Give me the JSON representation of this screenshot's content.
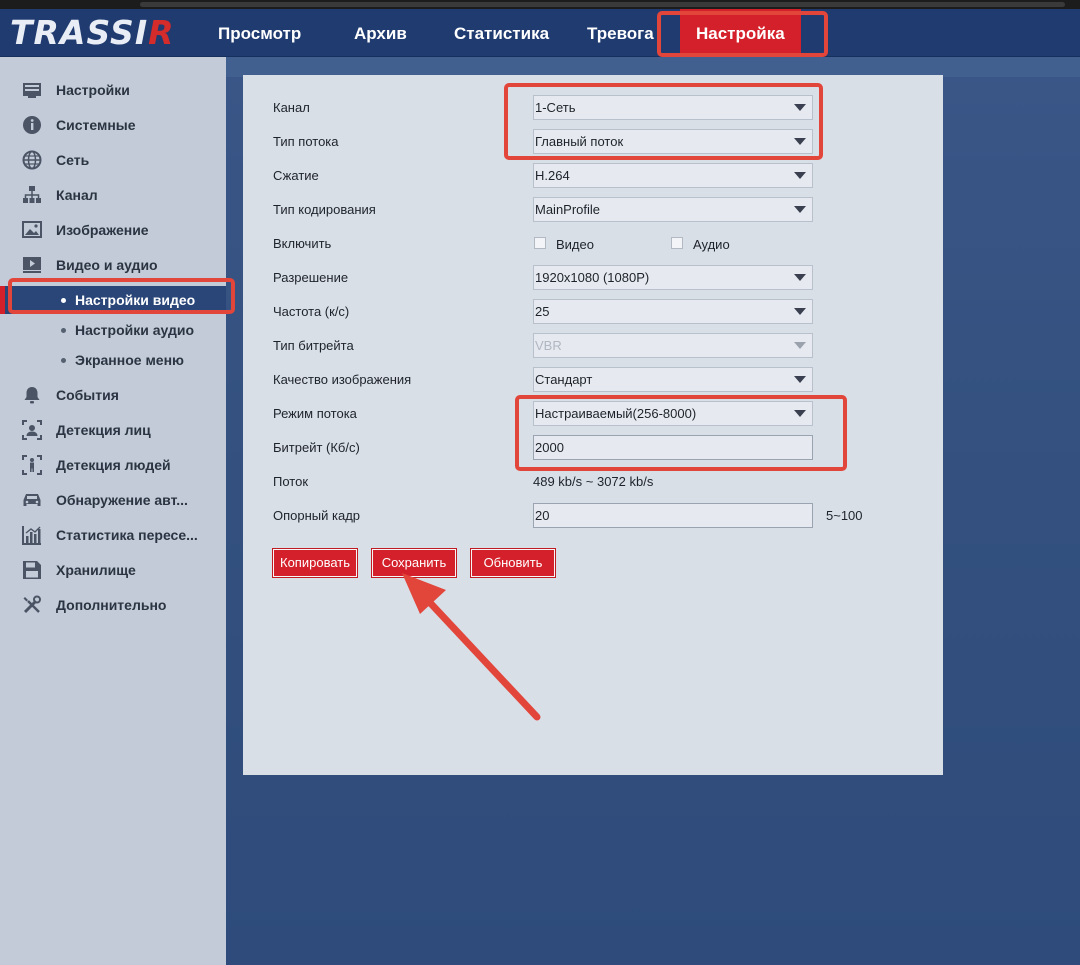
{
  "header": {
    "logo_main": "TRASSI",
    "logo_r": "R",
    "nav": [
      {
        "label": "Просмотр"
      },
      {
        "label": "Архив"
      },
      {
        "label": "Статистика"
      },
      {
        "label": "Тревога"
      },
      {
        "label": "Настройка",
        "active": true
      }
    ]
  },
  "sidebar": {
    "items": [
      {
        "label": "Настройки",
        "icon": "settings-icon"
      },
      {
        "label": "Системные",
        "icon": "info-icon"
      },
      {
        "label": "Сеть",
        "icon": "globe-icon"
      },
      {
        "label": "Канал",
        "icon": "channel-tree-icon"
      },
      {
        "label": "Изображение",
        "icon": "image-icon"
      },
      {
        "label": "Видео и аудио",
        "icon": "video-icon"
      }
    ],
    "subitems": [
      {
        "label": "Настройки видео",
        "active": true
      },
      {
        "label": "Настройки аудио"
      },
      {
        "label": "Экранное меню"
      }
    ],
    "items2": [
      {
        "label": "События",
        "icon": "bell-icon"
      },
      {
        "label": "Детекция лиц",
        "icon": "face-detect-icon"
      },
      {
        "label": "Детекция людей",
        "icon": "person-detect-icon"
      },
      {
        "label": "Обнаружение авт...",
        "icon": "car-icon"
      },
      {
        "label": "Статистика пересе...",
        "icon": "stats-icon"
      },
      {
        "label": "Хранилище",
        "icon": "floppy-icon"
      },
      {
        "label": "Дополнительно",
        "icon": "tools-icon"
      }
    ]
  },
  "form": {
    "channel": {
      "label": "Канал",
      "value": "1-Сеть"
    },
    "stream_type": {
      "label": "Тип потока",
      "value": "Главный поток"
    },
    "compression": {
      "label": "Сжатие",
      "value": "H.264"
    },
    "encoding_type": {
      "label": "Тип кодирования",
      "value": "MainProfile"
    },
    "enable": {
      "label": "Включить",
      "video": "Видео",
      "audio": "Аудио"
    },
    "resolution": {
      "label": "Разрешение",
      "value": "1920x1080 (1080P)"
    },
    "fps": {
      "label": "Частота (к/с)",
      "value": "25"
    },
    "bitrate_type": {
      "label": "Тип битрейта",
      "value": "VBR"
    },
    "quality": {
      "label": "Качество изображения",
      "value": "Стандарт"
    },
    "stream_mode": {
      "label": "Режим потока",
      "value": "Настраиваемый(256-8000)"
    },
    "bitrate": {
      "label": "Битрейт (Кб/с)",
      "value": "2000"
    },
    "stream": {
      "label": "Поток",
      "value": "489 kb/s ~ 3072 kb/s"
    },
    "keyframe": {
      "label": "Опорный кадр",
      "value": "20",
      "hint": "5~100"
    }
  },
  "buttons": {
    "copy": "Копировать",
    "save": "Сохранить",
    "refresh": "Обновить"
  },
  "colors": {
    "accent": "#d4202a",
    "annotation": "#e2453a",
    "header": "#1f3b70",
    "sidebar": "#c2cbd7",
    "panel": "#d9dfe7"
  }
}
